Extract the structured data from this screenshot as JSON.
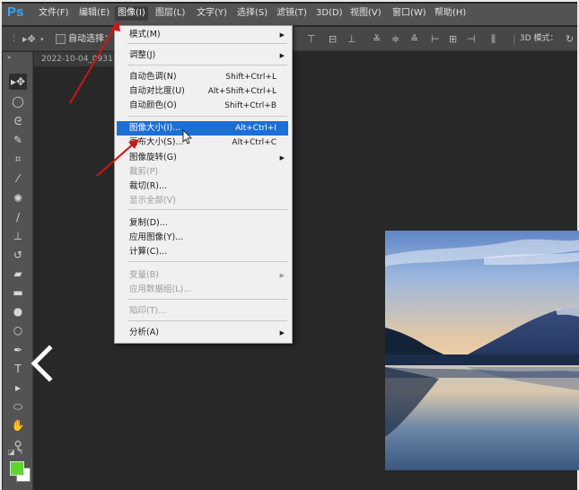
{
  "app": {
    "logo": "Ps",
    "document_tab": "2022-10-04_0931"
  },
  "menubar": {
    "items": [
      "文件(F)",
      "编辑(E)",
      "图像(I)",
      "图层(L)",
      "文字(Y)",
      "选择(S)",
      "滤镜(T)",
      "3D(D)",
      "视图(V)",
      "窗口(W)",
      "帮助(H)"
    ],
    "active_index": 2
  },
  "options_bar": {
    "auto_select_label": "自动选择：",
    "mode_3d_label": "3D 模式："
  },
  "image_menu": {
    "items": [
      {
        "label": "模式(M)",
        "shortcut": "",
        "submenu": true,
        "disabled": false,
        "highlight": false
      },
      {
        "label": "调整(J)",
        "shortcut": "",
        "submenu": true,
        "disabled": false,
        "highlight": false
      },
      {
        "label": "自动色调(N)",
        "shortcut": "Shift+Ctrl+L",
        "submenu": false,
        "disabled": false,
        "highlight": false
      },
      {
        "label": "自动对比度(U)",
        "shortcut": "Alt+Shift+Ctrl+L",
        "submenu": false,
        "disabled": false,
        "highlight": false
      },
      {
        "label": "自动颜色(O)",
        "shortcut": "Shift+Ctrl+B",
        "submenu": false,
        "disabled": false,
        "highlight": false
      },
      {
        "label": "图像大小(I)...",
        "shortcut": "Alt+Ctrl+I",
        "submenu": false,
        "disabled": false,
        "highlight": true
      },
      {
        "label": "画布大小(S)...",
        "shortcut": "Alt+Ctrl+C",
        "submenu": false,
        "disabled": false,
        "highlight": false
      },
      {
        "label": "图像旋转(G)",
        "shortcut": "",
        "submenu": true,
        "disabled": false,
        "highlight": false
      },
      {
        "label": "裁剪(P)",
        "shortcut": "",
        "submenu": false,
        "disabled": true,
        "highlight": false
      },
      {
        "label": "裁切(R)...",
        "shortcut": "",
        "submenu": false,
        "disabled": false,
        "highlight": false
      },
      {
        "label": "显示全部(V)",
        "shortcut": "",
        "submenu": false,
        "disabled": true,
        "highlight": false
      },
      {
        "label": "复制(D)...",
        "shortcut": "",
        "submenu": false,
        "disabled": false,
        "highlight": false
      },
      {
        "label": "应用图像(Y)...",
        "shortcut": "",
        "submenu": false,
        "disabled": false,
        "highlight": false
      },
      {
        "label": "计算(C)...",
        "shortcut": "",
        "submenu": false,
        "disabled": false,
        "highlight": false
      },
      {
        "label": "变量(B)",
        "shortcut": "",
        "submenu": true,
        "disabled": true,
        "highlight": false
      },
      {
        "label": "应用数据组(L)...",
        "shortcut": "",
        "submenu": false,
        "disabled": true,
        "highlight": false
      },
      {
        "label": "陷印(T)...",
        "shortcut": "",
        "submenu": false,
        "disabled": true,
        "highlight": false
      },
      {
        "label": "分析(A)",
        "shortcut": "",
        "submenu": true,
        "disabled": false,
        "highlight": false
      }
    ]
  },
  "tools": [
    {
      "name": "move-tool-icon",
      "glyph": "▸✥"
    },
    {
      "name": "elliptical-marquee-tool-icon",
      "glyph": "◯"
    },
    {
      "name": "lasso-tool-icon",
      "glyph": "ᘓ"
    },
    {
      "name": "quick-selection-tool-icon",
      "glyph": "✎"
    },
    {
      "name": "crop-tool-icon",
      "glyph": "⌗"
    },
    {
      "name": "eyedropper-tool-icon",
      "glyph": "⁄"
    },
    {
      "name": "spot-healing-brush-icon",
      "glyph": "✺"
    },
    {
      "name": "brush-tool-icon",
      "glyph": "∕"
    },
    {
      "name": "clone-stamp-tool-icon",
      "glyph": "⊥"
    },
    {
      "name": "history-brush-tool-icon",
      "glyph": "↺"
    },
    {
      "name": "eraser-tool-icon",
      "glyph": "▰"
    },
    {
      "name": "gradient-tool-icon",
      "glyph": "▬"
    },
    {
      "name": "blur-tool-icon",
      "glyph": "●"
    },
    {
      "name": "dodge-tool-icon",
      "glyph": "○"
    },
    {
      "name": "pen-tool-icon",
      "glyph": "✒"
    },
    {
      "name": "type-tool-icon",
      "glyph": "T"
    },
    {
      "name": "path-selection-tool-icon",
      "glyph": "▸"
    },
    {
      "name": "ellipse-shape-tool-icon",
      "glyph": "⬭"
    },
    {
      "name": "hand-tool-icon",
      "glyph": "✋"
    },
    {
      "name": "zoom-tool-icon",
      "glyph": "⚲"
    }
  ],
  "colors": {
    "foreground": "#5cd52c",
    "background": "#ffffff",
    "menu_highlight": "#1e6fd3",
    "annotation_arrow": "#d01414"
  }
}
